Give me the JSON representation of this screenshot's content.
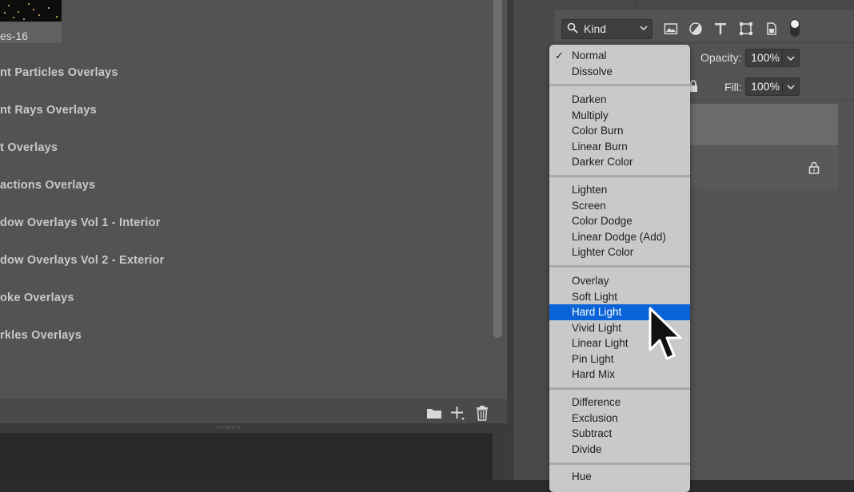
{
  "left_panel": {
    "thumbnail_label": "es-16",
    "groups": [
      "nt Particles Overlays",
      "nt Rays Overlays",
      "t Overlays",
      "actions Overlays",
      "dow Overlays Vol 1 - Interior",
      "dow Overlays Vol 2 - Exterior",
      "oke Overlays",
      "rkles Overlays"
    ],
    "footer_icons": [
      "folder-icon",
      "add-plus-icon",
      "trash-icon"
    ]
  },
  "layers_panel": {
    "filter": {
      "label": "Kind",
      "icons": [
        "search-icon",
        "image-filter-icon",
        "adjustment-filter-icon",
        "type-filter-icon",
        "shape-filter-icon",
        "smart-object-filter-icon"
      ]
    },
    "opacity": {
      "label": "Opacity:",
      "value": "100%"
    },
    "fill": {
      "label": "Fill:",
      "value": "100%"
    }
  },
  "blend_mode_menu": {
    "selected": "Normal",
    "highlighted": "Hard Light",
    "groups": [
      [
        "Normal",
        "Dissolve"
      ],
      [
        "Darken",
        "Multiply",
        "Color Burn",
        "Linear Burn",
        "Darker Color"
      ],
      [
        "Lighten",
        "Screen",
        "Color Dodge",
        "Linear Dodge (Add)",
        "Lighter Color"
      ],
      [
        "Overlay",
        "Soft Light",
        "Hard Light",
        "Vivid Light",
        "Linear Light",
        "Pin Light",
        "Hard Mix"
      ],
      [
        "Difference",
        "Exclusion",
        "Subtract",
        "Divide"
      ],
      [
        "Hue"
      ]
    ],
    "checkmark": "✓"
  },
  "colors": {
    "highlight": "#0a64d8",
    "menu_bg": "#c9c9c9",
    "panel_bg": "#535353"
  }
}
